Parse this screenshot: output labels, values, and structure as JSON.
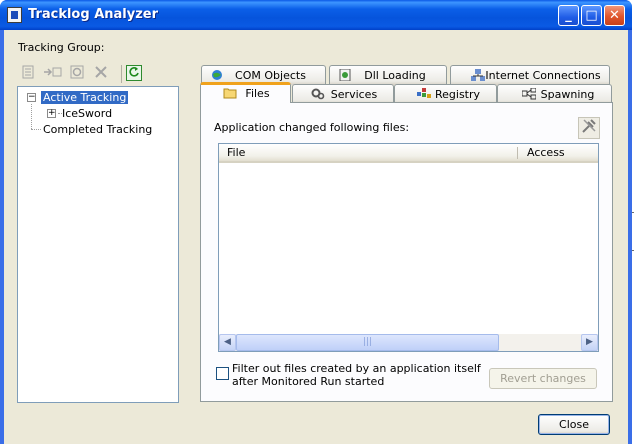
{
  "window": {
    "title": "Tracklog Analyzer",
    "min": "_",
    "max": "□",
    "close": "✕"
  },
  "group_label": "Tracking Group:",
  "tree": {
    "active": "Active Tracking",
    "child": "IceSword",
    "completed": "Completed Tracking"
  },
  "tabs": {
    "row1": [
      "COM Objects",
      "Dll Loading",
      "Internet Connections"
    ],
    "row2": [
      "Files",
      "Services",
      "Registry",
      "Spawning"
    ]
  },
  "panel": {
    "label": "Application changed following files:",
    "columns": [
      "File",
      "Access"
    ],
    "thumb_grip": "|||"
  },
  "filter": {
    "label": "Filter out files created by an application itself after Monitored Run started"
  },
  "buttons": {
    "revert": "Revert changes",
    "close": "Close"
  },
  "colors": {
    "title_blue": "#0654dc",
    "selection": "#316ac5",
    "tab_accent": "#f0a21c"
  }
}
